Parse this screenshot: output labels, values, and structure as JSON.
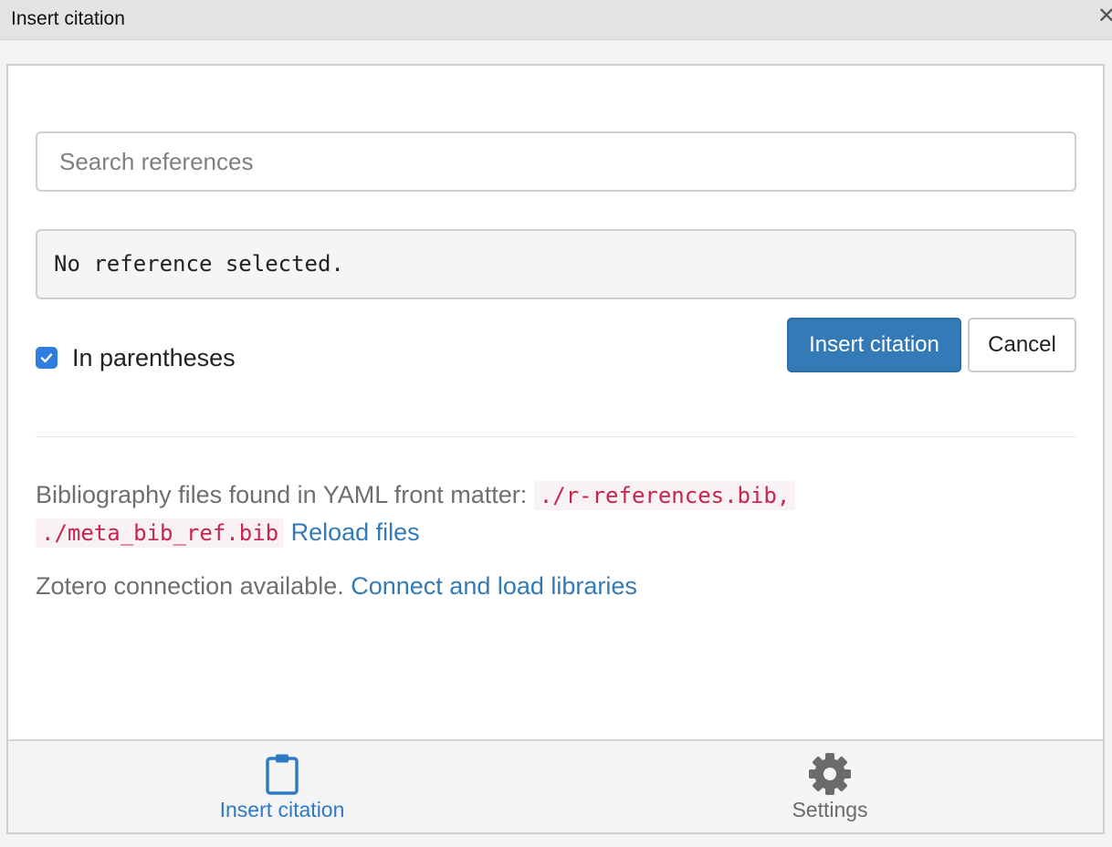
{
  "window": {
    "title": "Insert citation",
    "close_glyph": "✕"
  },
  "search": {
    "placeholder": "Search references",
    "value": ""
  },
  "selection": {
    "text": "No reference selected."
  },
  "options": {
    "in_parentheses_label": "In parentheses",
    "in_parentheses_checked": true
  },
  "buttons": {
    "insert_label": "Insert citation",
    "cancel_label": "Cancel"
  },
  "bibliography": {
    "prefix": "Bibliography files found in YAML front matter:",
    "files": [
      "./r-references.bib,",
      "./meta_bib_ref.bib"
    ],
    "reload_label": "Reload files"
  },
  "zotero": {
    "status": "Zotero connection available.",
    "connect_label": "Connect and load libraries"
  },
  "tabs": [
    {
      "label": "Insert citation",
      "icon": "clipboard-icon",
      "active": true
    },
    {
      "label": "Settings",
      "icon": "gear-icon",
      "active": false
    }
  ],
  "colors": {
    "primary": "#337ab7",
    "checkbox": "#2f7de1",
    "code_text": "#c7254e",
    "code_bg": "#f9f2f4",
    "link": "#337ab7"
  }
}
